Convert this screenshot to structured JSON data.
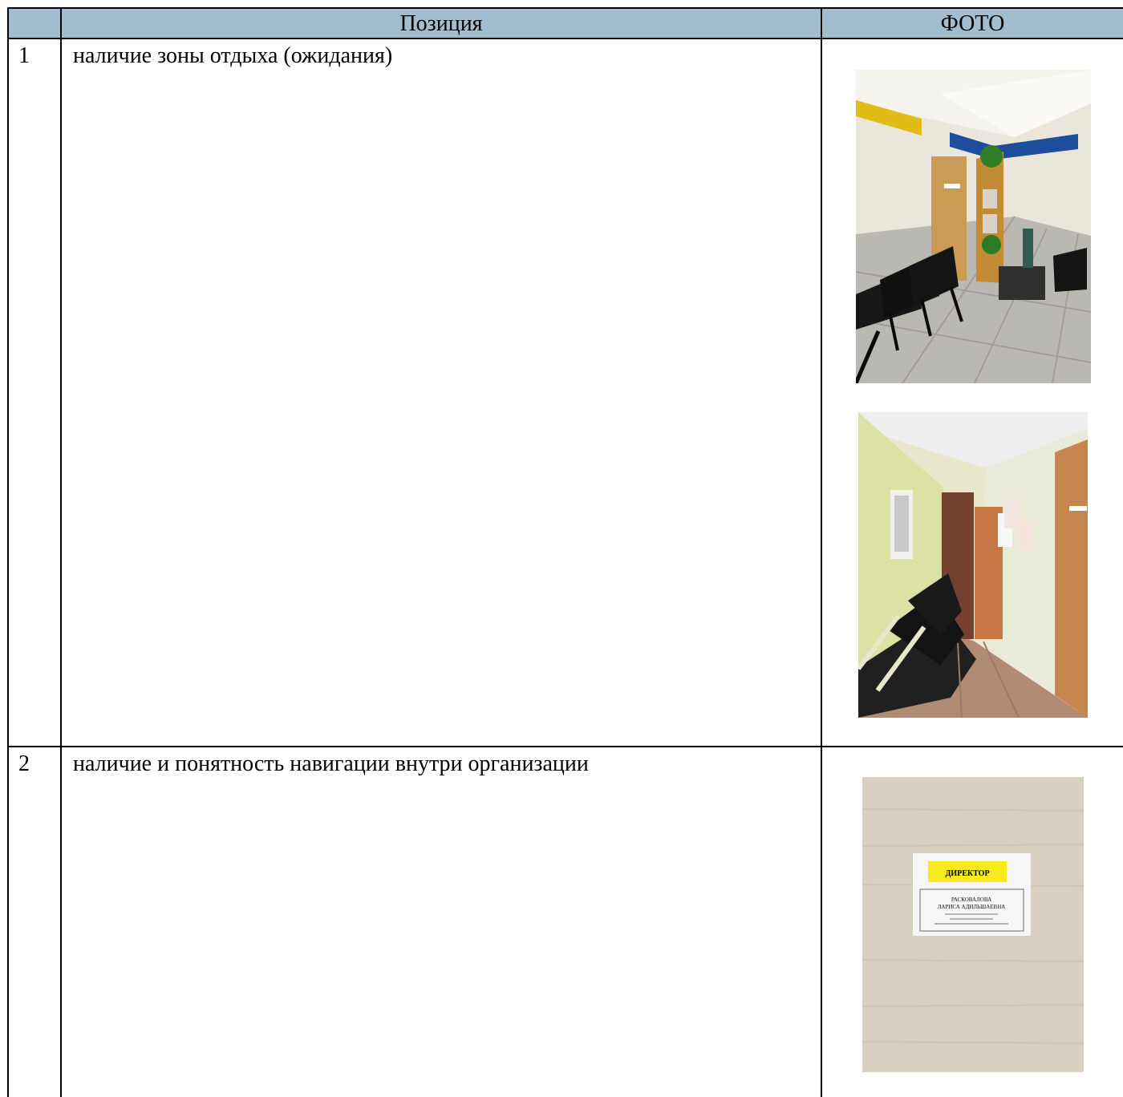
{
  "table": {
    "header": {
      "position_label": "Позиция",
      "photo_label": "ФОТО",
      "background_color": "#a3bdd0"
    },
    "rows": [
      {
        "number": "1",
        "position": "наличие зоны отдыха (ожидания)",
        "photos": [
          "waiting-area-photo",
          "corridor-photo"
        ]
      },
      {
        "number": "2",
        "position": "наличие и понятность навигации внутри организации",
        "photos": [
          "director-door-sign-photo"
        ]
      }
    ]
  },
  "sign": {
    "title": "ДИРЕКТОР",
    "name_line_1": "РАСКОВАЛОВА",
    "name_line_2": "ЛАРИСА АДИЛЬШАЕВНА"
  }
}
